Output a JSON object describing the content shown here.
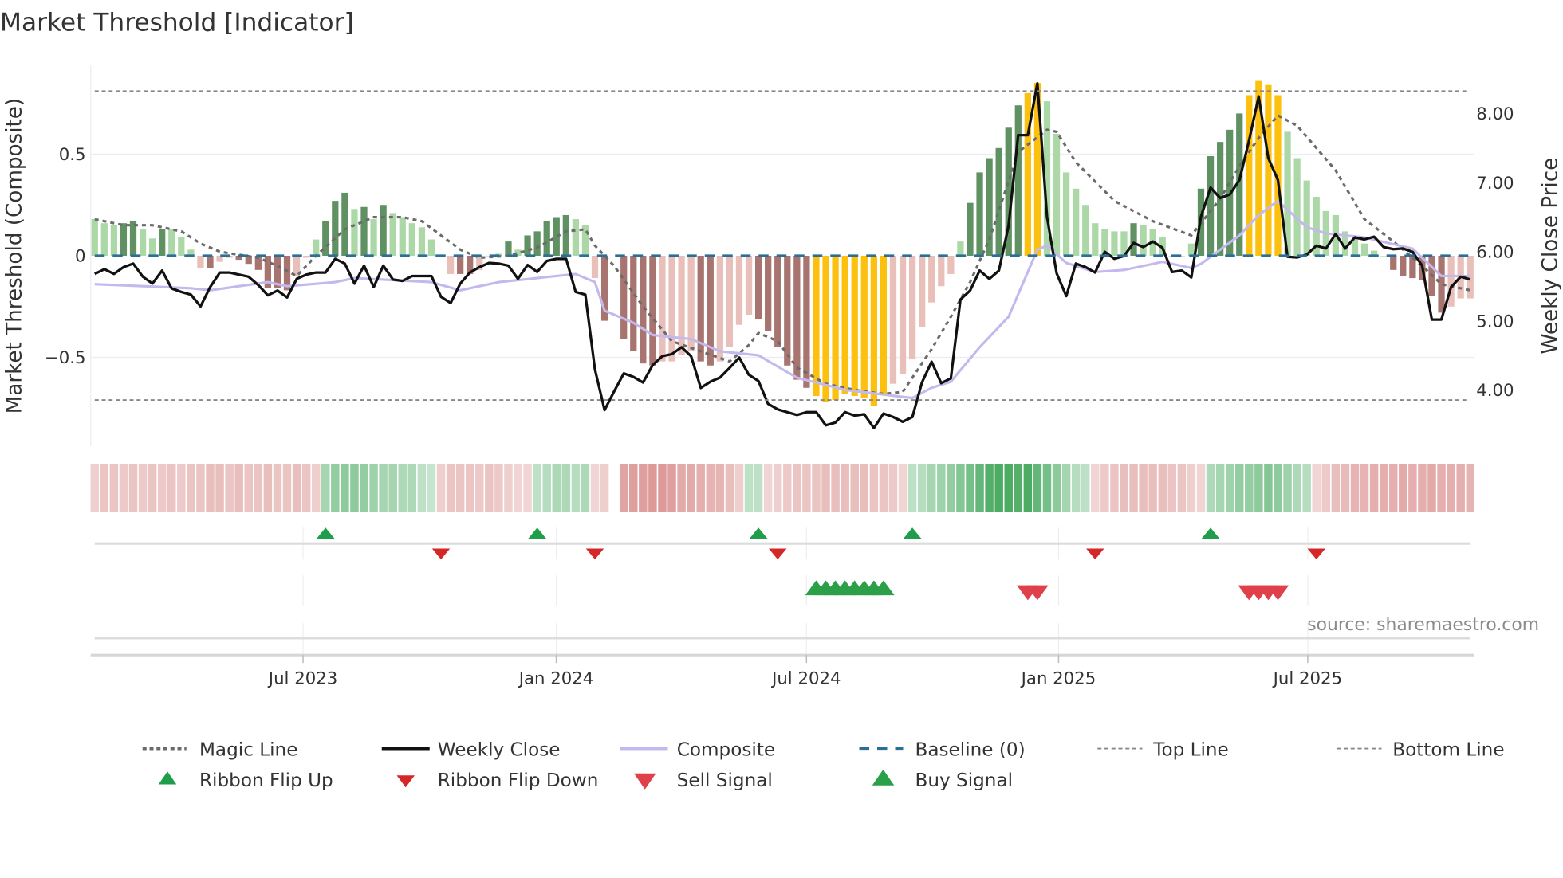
{
  "title": "Market Threshold [Indicator]",
  "source": "source: sharemaestro.com",
  "legend": {
    "magic_line": "Magic Line",
    "weekly_close": "Weekly Close",
    "composite": "Composite",
    "baseline": "Baseline (0)",
    "top_line": "Top Line",
    "bottom_line": "Bottom Line",
    "ribbon_flip_up": "Ribbon Flip Up",
    "ribbon_flip_down": "Ribbon Flip Down",
    "sell_signal": "Sell Signal",
    "buy_signal": "Buy Signal"
  },
  "colors": {
    "LG": "#acd8a7",
    "DG": "#5f9162",
    "LR": "#e9bfba",
    "DR": "#a8746f",
    "Y": "#fcc10f",
    "close": "#111111",
    "composite_line": "#c4b9ec",
    "magic": "#6b6b6b",
    "baseline": "#2a6f97",
    "ribbon_pos": "#34a04f",
    "ribbon_neg": "#d27a78",
    "flip_up": "#1e9e4a",
    "flip_down": "#d62728",
    "buy": "#2ca048",
    "sell": "#e0404a"
  },
  "chart_data": {
    "type": "bar",
    "title": "Market Threshold [Indicator]",
    "ylabel_left": "Market Threshold (Composite)",
    "ylabel_right": "Weekly Close Price",
    "ylim_left": [
      -0.936,
      0.94
    ],
    "ylim_right": [
      3.19,
      8.71
    ],
    "left_ticks": [
      {
        "value": 0.5,
        "label": "0.5"
      },
      {
        "value": 0,
        "label": "0"
      },
      {
        "value": -0.5,
        "label": "−0.5"
      }
    ],
    "right_ticks": [
      {
        "value": 8,
        "label": "8.00"
      },
      {
        "value": 7,
        "label": "7.00"
      },
      {
        "value": 6,
        "label": "6.00"
      },
      {
        "value": 5,
        "label": "5.00"
      },
      {
        "value": 4,
        "label": "4.00"
      }
    ],
    "x_ticks": [
      {
        "label": "Jul 2023",
        "week": 21.66
      },
      {
        "label": "Jan 2024",
        "week": 47.98
      },
      {
        "label": "Jul 2024",
        "week": 73.99
      },
      {
        "label": "Jan 2025",
        "week": 100.2
      },
      {
        "label": "Jul 2025",
        "week": 126.1
      }
    ],
    "weeks": 144,
    "top_line": 0.81,
    "bottom_line": -0.71,
    "baseline": 0,
    "composite_bars": [
      0.18,
      0.16,
      0.15,
      0.16,
      0.17,
      0.13,
      0.085,
      0.13,
      0.13,
      0.09,
      0.03,
      -0.06,
      -0.06,
      -0.03,
      -0.01,
      -0.02,
      -0.04,
      -0.07,
      -0.16,
      -0.16,
      -0.17,
      -0.1,
      -0.01,
      0.08,
      0.17,
      0.27,
      0.31,
      0.23,
      0.24,
      0.18,
      0.25,
      0.21,
      0.19,
      0.16,
      0.14,
      0.08,
      0,
      -0.09,
      -0.09,
      -0.09,
      -0.07,
      0,
      0.01,
      0.07,
      0.03,
      0.1,
      0.12,
      0.17,
      0.19,
      0.2,
      0.18,
      0.15,
      -0.11,
      -0.32,
      null,
      -0.41,
      -0.47,
      -0.53,
      -0.54,
      -0.52,
      -0.52,
      -0.49,
      -0.47,
      -0.52,
      -0.54,
      -0.52,
      -0.45,
      -0.34,
      -0.29,
      -0.31,
      -0.37,
      -0.45,
      -0.54,
      -0.61,
      -0.65,
      -0.69,
      -0.72,
      -0.71,
      -0.68,
      -0.69,
      -0.7,
      -0.74,
      -0.68,
      -0.63,
      -0.58,
      -0.51,
      -0.35,
      -0.23,
      -0.15,
      -0.09,
      0.07,
      0.26,
      0.41,
      0.48,
      0.53,
      0.63,
      0.74,
      0.8,
      0.85,
      0.76,
      0.6,
      0.41,
      0.33,
      0.25,
      0.16,
      0.13,
      0.12,
      0.12,
      0.16,
      0.15,
      0.13,
      0.09,
      0,
      0,
      0.06,
      0.33,
      0.49,
      0.56,
      0.62,
      0.7,
      0.79,
      0.86,
      0.84,
      0.79,
      0.61,
      0.48,
      0.37,
      0.29,
      0.22,
      0.2,
      0.12,
      0.086,
      0.06,
      0.025,
      0,
      -0.07,
      -0.1,
      -0.11,
      -0.12,
      -0.2,
      -0.28,
      -0.25,
      -0.21,
      -0.21
    ],
    "bar_state": [
      "LG",
      "LG",
      "LG",
      "DG",
      "DG",
      "LG",
      "LG",
      "DG",
      "LG",
      "LG",
      "LG",
      "LR",
      "DR",
      "LR",
      "LR",
      "DR",
      "DR",
      "DR",
      "DR",
      "DR",
      "DR",
      "LR",
      "LR",
      "LG",
      "DG",
      "DG",
      "DG",
      "LG",
      "DG",
      "LG",
      "DG",
      "LG",
      "LG",
      "LG",
      "LG",
      "LG",
      "LG",
      "LR",
      "DR",
      "DR",
      "LR",
      "LR",
      "LG",
      "DG",
      "LG",
      "DG",
      "DG",
      "DG",
      "DG",
      "DG",
      "LG",
      "LG",
      "LR",
      "DR",
      "LR",
      "DR",
      "DR",
      "DR",
      "DR",
      "LR",
      "LR",
      "LR",
      "LR",
      "DR",
      "DR",
      "LR",
      "LR",
      "LR",
      "LR",
      "DR",
      "DR",
      "DR",
      "DR",
      "DR",
      "DR",
      "Y",
      "Y",
      "Y",
      "Y",
      "Y",
      "Y",
      "Y",
      "Y",
      "LR",
      "LR",
      "LR",
      "LR",
      "LR",
      "LR",
      "LR",
      "LG",
      "DG",
      "DG",
      "DG",
      "DG",
      "DG",
      "DG",
      "Y",
      "Y",
      "LG",
      "LG",
      "LG",
      "LG",
      "LG",
      "LG",
      "LG",
      "LG",
      "LG",
      "DG",
      "LG",
      "LG",
      "LG",
      "LG",
      "LG",
      "LG",
      "DG",
      "DG",
      "DG",
      "DG",
      "DG",
      "Y",
      "Y",
      "Y",
      "Y",
      "LG",
      "LG",
      "LG",
      "LG",
      "LG",
      "LG",
      "LG",
      "LG",
      "LG",
      "LG",
      "LG",
      "DR",
      "DR",
      "DR",
      "DR",
      "DR",
      "DR",
      "LR",
      "LR",
      "LR"
    ],
    "weekly_close": [
      5.68,
      5.75,
      5.68,
      5.78,
      5.83,
      5.64,
      5.54,
      5.73,
      5.47,
      5.42,
      5.38,
      5.21,
      5.49,
      5.7,
      5.7,
      5.67,
      5.64,
      5.52,
      5.37,
      5.44,
      5.34,
      5.61,
      5.67,
      5.7,
      5.7,
      5.9,
      5.83,
      5.54,
      5.8,
      5.49,
      5.8,
      5.6,
      5.58,
      5.65,
      5.65,
      5.65,
      5.35,
      5.26,
      5.54,
      5.7,
      5.78,
      5.84,
      5.83,
      5.8,
      5.61,
      5.81,
      5.71,
      5.87,
      5.9,
      5.9,
      5.42,
      5.38,
      4.3,
      3.71,
      3.98,
      4.24,
      4.19,
      4.11,
      4.36,
      4.49,
      4.52,
      4.62,
      4.49,
      4.03,
      4.12,
      4.18,
      4.32,
      4.47,
      4.22,
      4.13,
      3.8,
      3.72,
      3.68,
      3.64,
      3.68,
      3.68,
      3.49,
      3.53,
      3.68,
      3.63,
      3.65,
      3.45,
      3.66,
      3.61,
      3.54,
      3.61,
      4.11,
      4.41,
      4.1,
      4.17,
      5.31,
      5.44,
      5.73,
      5.61,
      5.73,
      6.38,
      7.69,
      7.69,
      8.44,
      6.5,
      5.69,
      5.36,
      5.83,
      5.78,
      5.7,
      6.0,
      5.9,
      5.94,
      6.13,
      6.07,
      6.15,
      6.06,
      5.71,
      5.73,
      5.63,
      6.51,
      6.93,
      6.78,
      6.83,
      7.04,
      7.61,
      8.25,
      7.36,
      7.04,
      5.93,
      5.92,
      5.96,
      6.09,
      6.05,
      6.26,
      6.05,
      6.21,
      6.18,
      6.22,
      6.07,
      6.04,
      6.05,
      6.0,
      5.8,
      5.02,
      5.02,
      5.49,
      5.64,
      5.6
    ],
    "composite_line": [
      [
        0,
        -0.14
      ],
      [
        10,
        -0.16
      ],
      [
        12,
        -0.17
      ],
      [
        18,
        -0.13
      ],
      [
        20,
        -0.15
      ],
      [
        25,
        -0.13
      ],
      [
        27,
        -0.11
      ],
      [
        35,
        -0.13
      ],
      [
        38,
        -0.17
      ],
      [
        42,
        -0.13
      ],
      [
        48,
        -0.1
      ],
      [
        50,
        -0.09
      ],
      [
        52,
        -0.13
      ],
      [
        53,
        -0.27
      ],
      [
        56,
        -0.33
      ],
      [
        58,
        -0.39
      ],
      [
        62,
        -0.41
      ],
      [
        65,
        -0.47
      ],
      [
        69,
        -0.49
      ],
      [
        73,
        -0.6
      ],
      [
        78,
        -0.66
      ],
      [
        85,
        -0.7
      ],
      [
        87,
        -0.65
      ],
      [
        89,
        -0.62
      ],
      [
        92,
        -0.45
      ],
      [
        95,
        -0.3
      ],
      [
        98,
        0.03
      ],
      [
        99,
        0.05
      ],
      [
        101,
        -0.035
      ],
      [
        104,
        -0.08
      ],
      [
        107,
        -0.07
      ],
      [
        111,
        -0.03
      ],
      [
        114,
        -0.06
      ],
      [
        115,
        -0.04
      ],
      [
        119,
        0.1
      ],
      [
        121,
        0.2
      ],
      [
        123,
        0.27
      ],
      [
        126,
        0.14
      ],
      [
        128,
        0.11
      ],
      [
        132,
        0.09
      ],
      [
        137,
        0.035
      ],
      [
        140,
        -0.1
      ],
      [
        143,
        -0.1
      ]
    ],
    "magic_line": [
      [
        0,
        0.18
      ],
      [
        3,
        0.15
      ],
      [
        6,
        0.15
      ],
      [
        9,
        0.12
      ],
      [
        11,
        0.06
      ],
      [
        13,
        0.02
      ],
      [
        17,
        -0.01
      ],
      [
        19,
        -0.05
      ],
      [
        21,
        -0.1
      ],
      [
        23,
        0
      ],
      [
        26,
        0.13
      ],
      [
        29,
        0.19
      ],
      [
        32,
        0.19
      ],
      [
        34,
        0.17
      ],
      [
        36,
        0.1
      ],
      [
        38,
        0.03
      ],
      [
        40,
        -0.01
      ],
      [
        43,
        0
      ],
      [
        46,
        0.04
      ],
      [
        49,
        0.12
      ],
      [
        51,
        0.13
      ],
      [
        52,
        0.05
      ],
      [
        54,
        -0.05
      ],
      [
        57,
        -0.25
      ],
      [
        60,
        -0.42
      ],
      [
        63,
        -0.47
      ],
      [
        66,
        -0.52
      ],
      [
        68,
        -0.44
      ],
      [
        69,
        -0.38
      ],
      [
        71,
        -0.42
      ],
      [
        73,
        -0.55
      ],
      [
        76,
        -0.63
      ],
      [
        79,
        -0.66
      ],
      [
        82,
        -0.68
      ],
      [
        84,
        -0.67
      ],
      [
        87,
        -0.46
      ],
      [
        89,
        -0.3
      ],
      [
        91,
        -0.13
      ],
      [
        93,
        0.08
      ],
      [
        96,
        0.51
      ],
      [
        99,
        0.62
      ],
      [
        100,
        0.61
      ],
      [
        102,
        0.46
      ],
      [
        106,
        0.27
      ],
      [
        110,
        0.17
      ],
      [
        114,
        0.1
      ],
      [
        117,
        0.28
      ],
      [
        119,
        0.44
      ],
      [
        121,
        0.58
      ],
      [
        123,
        0.69
      ],
      [
        125,
        0.64
      ],
      [
        129,
        0.42
      ],
      [
        132,
        0.18
      ],
      [
        135,
        0.07
      ],
      [
        138,
        -0.05
      ],
      [
        140,
        -0.14
      ],
      [
        143,
        -0.17
      ]
    ],
    "ribbon": [
      -0.2,
      -0.3,
      -0.3,
      -0.25,
      -0.3,
      -0.25,
      -0.3,
      -0.25,
      -0.3,
      -0.25,
      -0.3,
      -0.3,
      -0.35,
      -0.35,
      -0.3,
      -0.35,
      -0.3,
      -0.3,
      -0.35,
      -0.3,
      -0.3,
      -0.35,
      -0.3,
      -0.2,
      0.3,
      0.4,
      0.45,
      0.45,
      0.4,
      0.35,
      0.3,
      0.3,
      0.25,
      0.25,
      0.15,
      0.1,
      -0.2,
      -0.3,
      -0.3,
      -0.3,
      -0.25,
      -0.3,
      -0.25,
      -0.2,
      -0.15,
      -0.15,
      0.15,
      0.2,
      0.25,
      0.25,
      0.2,
      0.25,
      -0.15,
      -0.2,
      null,
      -0.6,
      -0.65,
      -0.65,
      -0.7,
      -0.7,
      -0.65,
      -0.55,
      -0.55,
      -0.5,
      -0.45,
      -0.45,
      -0.35,
      -0.2,
      0.15,
      0.15,
      -0.15,
      -0.2,
      -0.25,
      -0.3,
      -0.3,
      -0.3,
      -0.35,
      -0.35,
      -0.35,
      -0.35,
      -0.35,
      -0.3,
      -0.3,
      -0.25,
      -0.15,
      0.15,
      0.2,
      0.3,
      0.35,
      0.4,
      0.5,
      0.6,
      0.7,
      0.8,
      0.85,
      0.85,
      0.8,
      0.85,
      0.7,
      0.6,
      0.45,
      0.3,
      0.2,
      0.15,
      -0.15,
      -0.25,
      -0.3,
      -0.35,
      -0.35,
      -0.35,
      -0.35,
      -0.35,
      -0.3,
      -0.3,
      -0.2,
      -0.15,
      0.25,
      0.3,
      0.35,
      0.4,
      0.4,
      0.45,
      0.5,
      0.45,
      0.35,
      0.25,
      0.2,
      -0.15,
      -0.25,
      -0.35,
      -0.4,
      -0.45,
      -0.45,
      -0.5,
      -0.5,
      -0.5,
      -0.55,
      -0.5,
      -0.5,
      -0.55,
      -0.5,
      -0.5,
      -0.5,
      -0.45
    ],
    "ribbon_flip_up": [
      24,
      46,
      69,
      85,
      116
    ],
    "ribbon_flip_down": [
      36,
      52,
      71,
      104,
      127
    ],
    "buy_signal": [
      75,
      76,
      77,
      78,
      79,
      80,
      81,
      82
    ],
    "sell_signal": [
      97,
      98,
      120,
      121,
      122,
      123
    ]
  }
}
